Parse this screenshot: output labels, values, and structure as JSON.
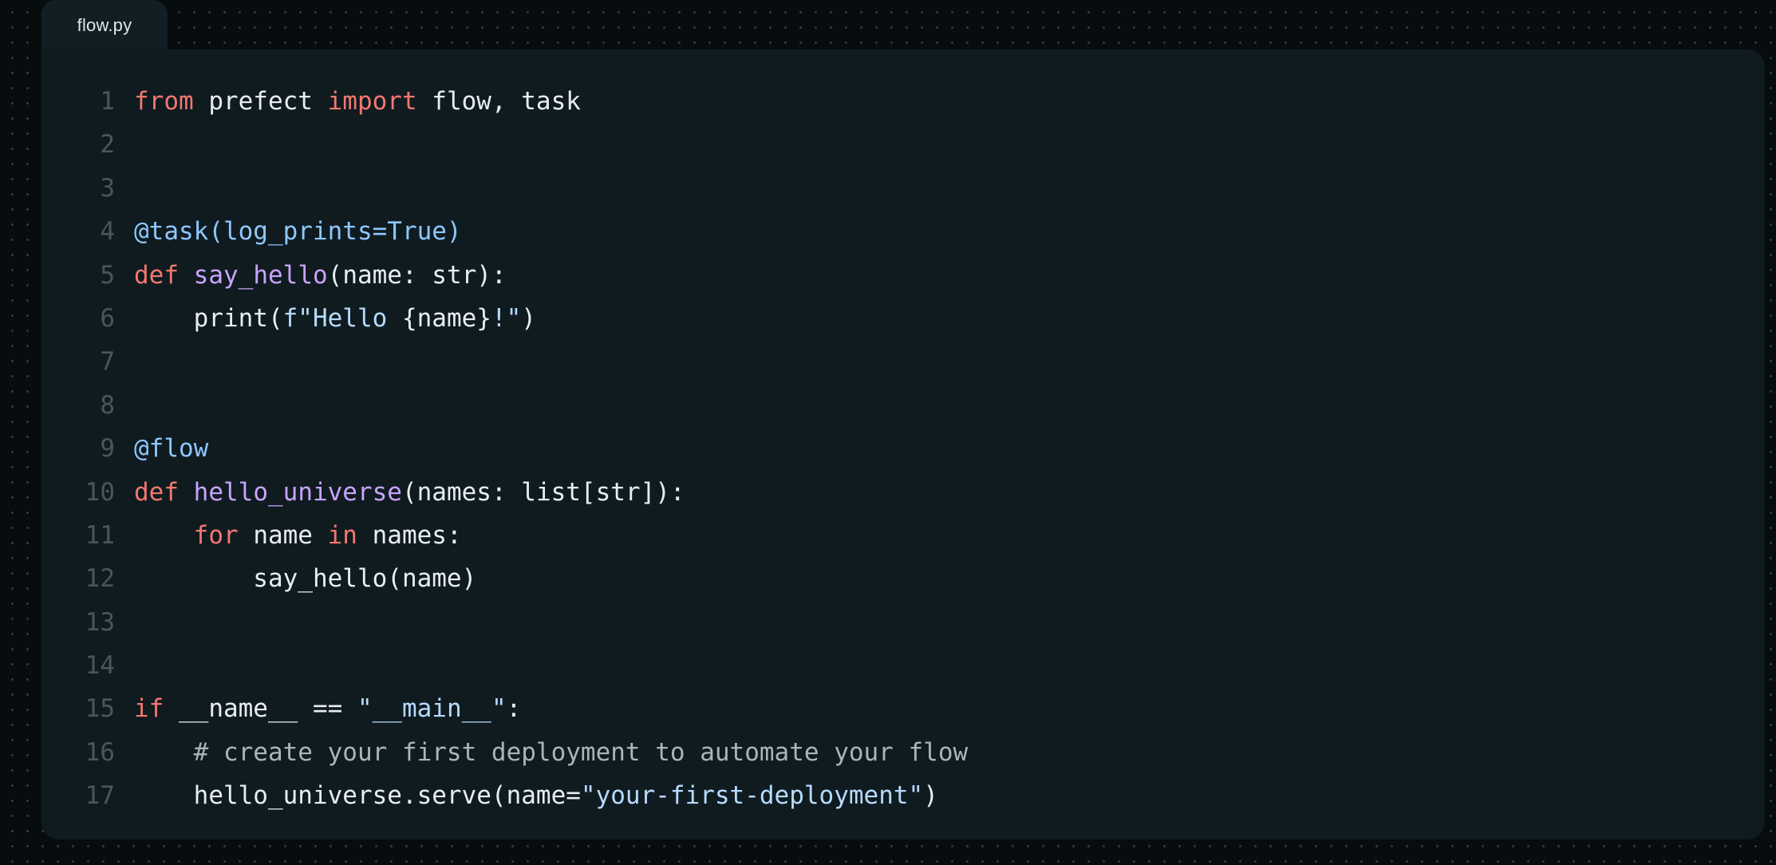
{
  "tab": {
    "label": "flow.py"
  },
  "lines": [
    {
      "n": "1",
      "tokens": [
        {
          "t": "from",
          "c": "kw"
        },
        {
          "t": " prefect ",
          "c": "plain"
        },
        {
          "t": "import",
          "c": "kw"
        },
        {
          "t": " flow, task",
          "c": "plain"
        }
      ]
    },
    {
      "n": "2",
      "tokens": []
    },
    {
      "n": "3",
      "tokens": []
    },
    {
      "n": "4",
      "tokens": [
        {
          "t": "@task(log_prints=True)",
          "c": "deco"
        }
      ]
    },
    {
      "n": "5",
      "tokens": [
        {
          "t": "def",
          "c": "kw"
        },
        {
          "t": " ",
          "c": "plain"
        },
        {
          "t": "say_hello",
          "c": "fn"
        },
        {
          "t": "(name: str):",
          "c": "plain"
        }
      ]
    },
    {
      "n": "6",
      "tokens": [
        {
          "t": "    print(",
          "c": "plain"
        },
        {
          "t": "f\"Hello ",
          "c": "str"
        },
        {
          "t": "{name}",
          "c": "plain"
        },
        {
          "t": "!\"",
          "c": "str"
        },
        {
          "t": ")",
          "c": "plain"
        }
      ]
    },
    {
      "n": "7",
      "tokens": []
    },
    {
      "n": "8",
      "tokens": []
    },
    {
      "n": "9",
      "tokens": [
        {
          "t": "@flow",
          "c": "deco"
        }
      ]
    },
    {
      "n": "10",
      "tokens": [
        {
          "t": "def",
          "c": "kw"
        },
        {
          "t": " ",
          "c": "plain"
        },
        {
          "t": "hello_universe",
          "c": "fn"
        },
        {
          "t": "(names: list[str]):",
          "c": "plain"
        }
      ]
    },
    {
      "n": "11",
      "tokens": [
        {
          "t": "    ",
          "c": "plain"
        },
        {
          "t": "for",
          "c": "kw"
        },
        {
          "t": " name ",
          "c": "plain"
        },
        {
          "t": "in",
          "c": "kw"
        },
        {
          "t": " names:",
          "c": "plain"
        }
      ]
    },
    {
      "n": "12",
      "tokens": [
        {
          "t": "        say_hello(name)",
          "c": "plain"
        }
      ]
    },
    {
      "n": "13",
      "tokens": []
    },
    {
      "n": "14",
      "tokens": []
    },
    {
      "n": "15",
      "tokens": [
        {
          "t": "if",
          "c": "kw"
        },
        {
          "t": " __name__ == ",
          "c": "plain"
        },
        {
          "t": "\"__main__\"",
          "c": "str"
        },
        {
          "t": ":",
          "c": "plain"
        }
      ]
    },
    {
      "n": "16",
      "tokens": [
        {
          "t": "    # create your first deployment to automate your flow",
          "c": "comment"
        }
      ]
    },
    {
      "n": "17",
      "tokens": [
        {
          "t": "    hello_universe.serve(name=",
          "c": "plain"
        },
        {
          "t": "\"your-first-deployment\"",
          "c": "str"
        },
        {
          "t": ")",
          "c": "plain"
        }
      ]
    }
  ],
  "colors": {
    "keyword": "#f2786f",
    "decorator": "#8ec7ff",
    "function": "#c8a4ff",
    "string": "#b6dbff",
    "comment": "#a9b5bb",
    "plain": "#e6eef2",
    "line_number": "#4a565d",
    "panel": "#101b20",
    "background": "#070c0f"
  }
}
